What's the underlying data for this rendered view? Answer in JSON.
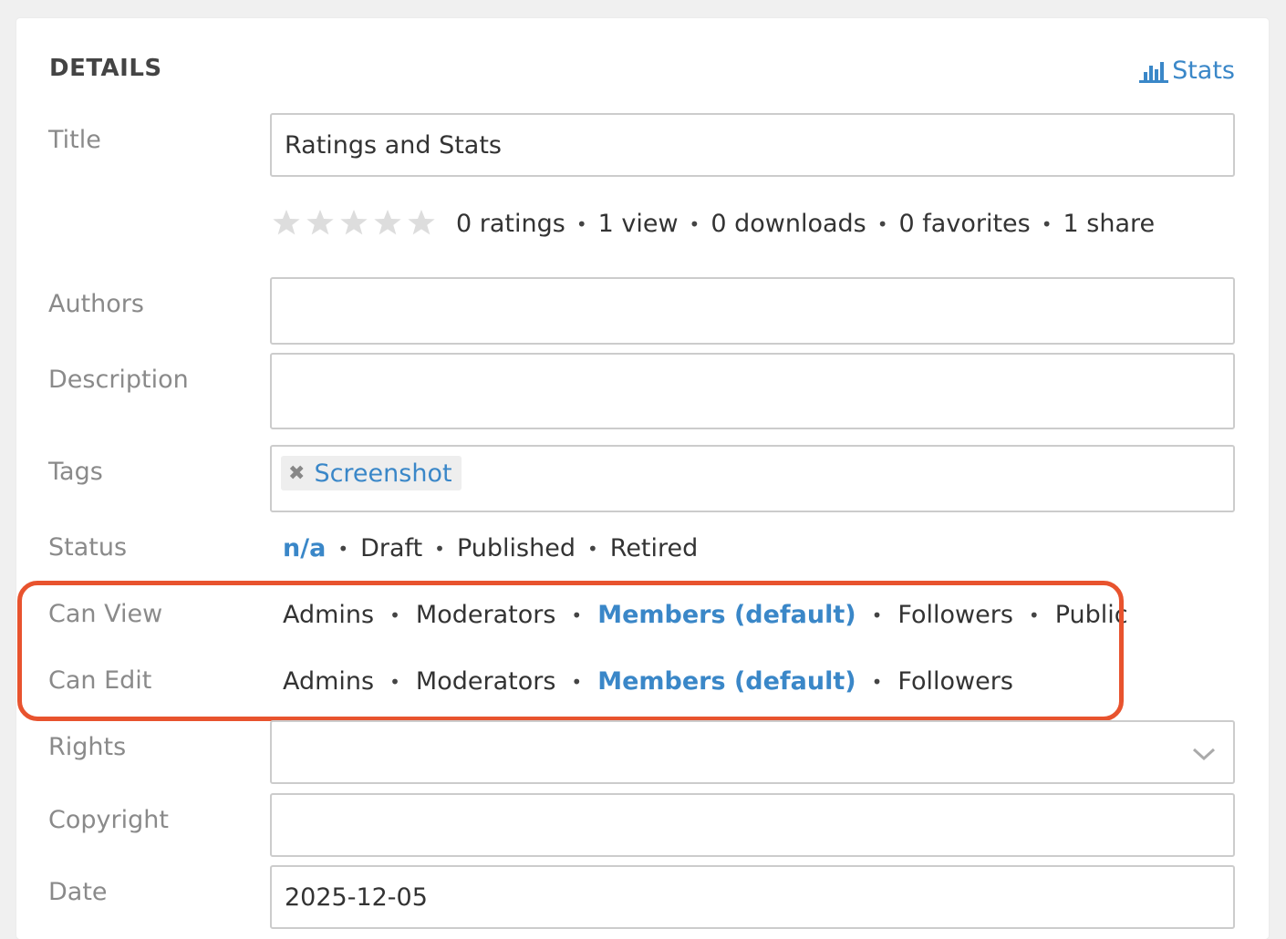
{
  "section": {
    "heading": "DETAILS",
    "stats_link": "Stats"
  },
  "fields": {
    "title": {
      "label": "Title",
      "value": "Ratings and Stats"
    },
    "authors": {
      "label": "Authors",
      "value": ""
    },
    "description": {
      "label": "Description",
      "value": ""
    },
    "tags": {
      "label": "Tags",
      "items": [
        "Screenshot"
      ]
    },
    "status": {
      "label": "Status",
      "options": [
        "n/a",
        "Draft",
        "Published",
        "Retired"
      ],
      "selected": "n/a"
    },
    "can_view": {
      "label": "Can View",
      "options": [
        "Admins",
        "Moderators",
        "Members (default)",
        "Followers",
        "Public"
      ],
      "selected": "Members (default)"
    },
    "can_edit": {
      "label": "Can Edit",
      "options": [
        "Admins",
        "Moderators",
        "Members (default)",
        "Followers"
      ],
      "selected": "Members (default)"
    },
    "rights": {
      "label": "Rights",
      "value": ""
    },
    "copyright": {
      "label": "Copyright",
      "value": ""
    },
    "date": {
      "label": "Date",
      "value": "2025-12-05"
    }
  },
  "rating": {
    "stars_total": 5,
    "stars_filled": 0,
    "stats": [
      "0 ratings",
      "1 view",
      "0 downloads",
      "0 favorites",
      "1 share"
    ]
  },
  "colors": {
    "accent": "#3a87c8",
    "highlight_border": "#e8532e",
    "star_empty": "#dddddd"
  },
  "icons": {
    "stats": "bar-chart-icon",
    "tag_remove": "close-icon",
    "rights_dropdown": "chevron-down-icon",
    "star": "star-icon"
  }
}
